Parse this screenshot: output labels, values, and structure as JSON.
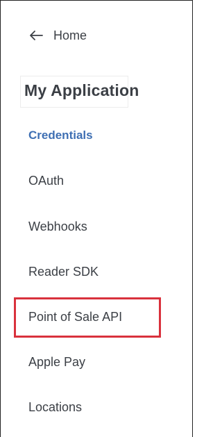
{
  "home": {
    "label": "Home",
    "icon": "arrow-left-icon"
  },
  "app_title": "My Application",
  "nav": {
    "items": [
      {
        "label": "Credentials",
        "active": true
      },
      {
        "label": "OAuth",
        "active": false
      },
      {
        "label": "Webhooks",
        "active": false
      },
      {
        "label": "Reader SDK",
        "active": false
      },
      {
        "label": "Point of Sale API",
        "active": false,
        "highlighted": true
      },
      {
        "label": "Apple Pay",
        "active": false
      },
      {
        "label": "Locations",
        "active": false
      }
    ]
  },
  "colors": {
    "text": "#3b3f45",
    "active": "#3e6fb3",
    "highlight_border": "#d9313c"
  }
}
